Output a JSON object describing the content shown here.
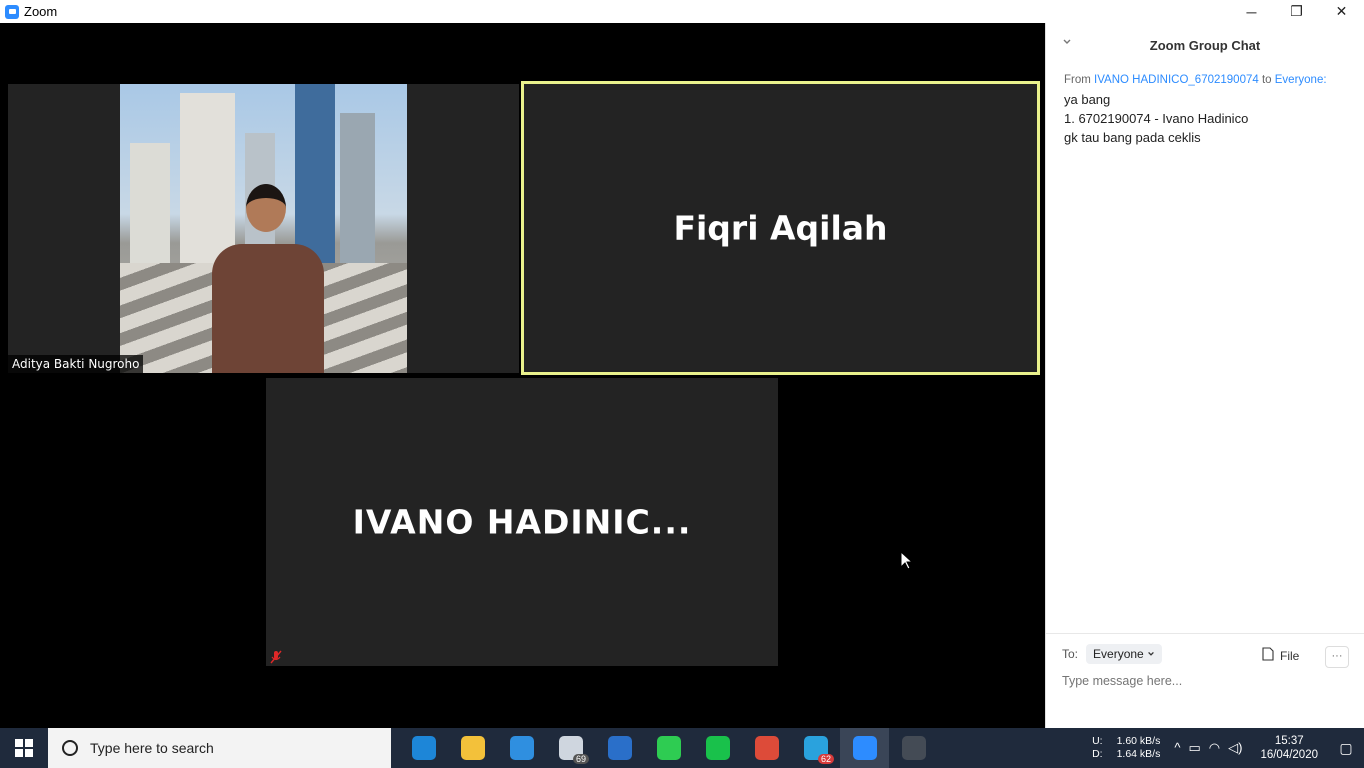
{
  "window": {
    "title": "Zoom",
    "controls": [
      "─",
      "❐",
      "✕"
    ]
  },
  "participants": {
    "aditya": {
      "name": "Aditya Bakti Nugroho"
    },
    "fiqri": {
      "name": "Fiqri Aqilah"
    },
    "ivano": {
      "name": "IVANO  HADINIC..."
    }
  },
  "chat": {
    "title": "Zoom Group Chat",
    "message": {
      "from_label": "From",
      "sender": "IVANO HADINICO_6702190074",
      "to_label": "to",
      "recipient": "Everyone:",
      "lines": [
        "ya bang",
        "1. 6702190074 - Ivano Hadinico",
        "gk tau bang pada ceklis"
      ]
    },
    "to_label": "To:",
    "to_value": "Everyone",
    "file_label": "File",
    "more_label": "···",
    "input_placeholder": "Type message here..."
  },
  "taskbar": {
    "search_placeholder": "Type here to search",
    "apps": [
      {
        "name": "edge-icon",
        "color": "#1d86d8"
      },
      {
        "name": "file-explorer-icon",
        "color": "#f3c13a"
      },
      {
        "name": "store-icon",
        "color": "#2f8fe0"
      },
      {
        "name": "mail-icon",
        "color": "#cfd6df",
        "badge": "69"
      },
      {
        "name": "reader-icon",
        "color": "#2a6fc9"
      },
      {
        "name": "whatsapp-icon",
        "color": "#2ecc52"
      },
      {
        "name": "line-icon",
        "color": "#19c14b"
      },
      {
        "name": "chrome-icon",
        "color": "#dd4b39"
      },
      {
        "name": "telegram-icon",
        "color": "#2aa2dd",
        "badge": "62"
      },
      {
        "name": "zoom-icon",
        "color": "#2d8cff"
      },
      {
        "name": "obs-icon",
        "color": "#444b55"
      }
    ],
    "net_up_label": "U:",
    "net_up": "1.60 kB/s",
    "net_down_label": "D:",
    "net_down": "1.64 kB/s",
    "time": "15:37",
    "date": "16/04/2020"
  }
}
